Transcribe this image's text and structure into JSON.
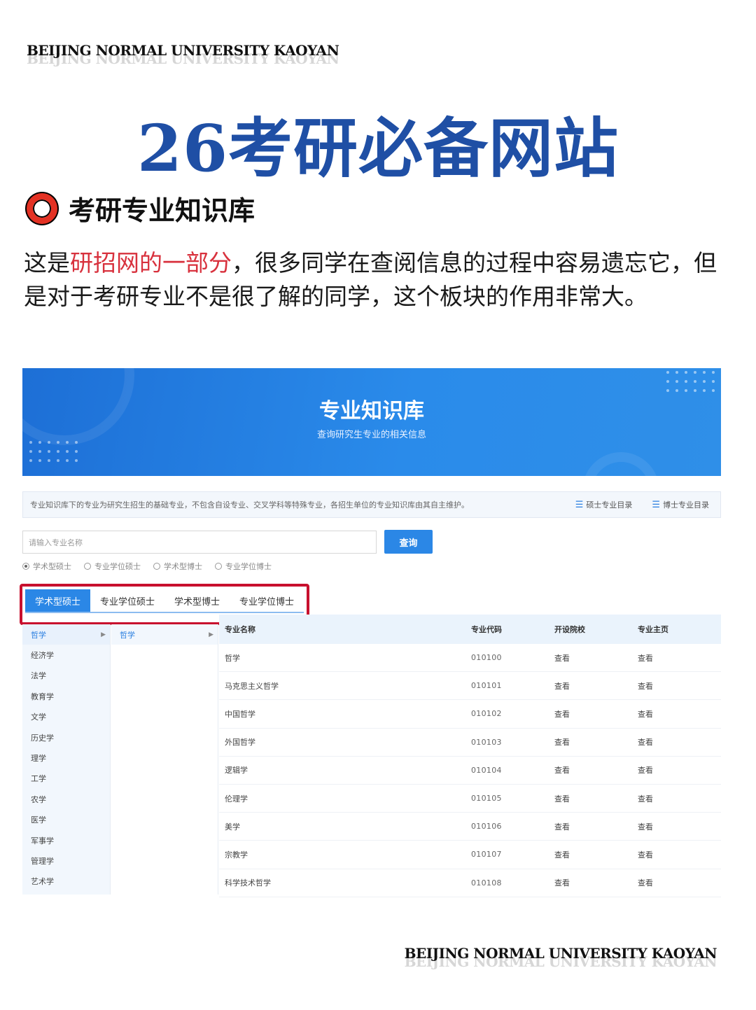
{
  "brand": "BEIJING NORMAL UNIVERSITY KAOYAN",
  "title": "26考研必备网站",
  "section_title": "考研专业知识库",
  "paragraph": {
    "part1": "这是",
    "highlight": "研招网的一部分",
    "part2": "，很多同学在查阅信息的过程中容易遗忘它，但是对于考研专业不是很了解的同学，这个板块的作用非常大。"
  },
  "colors": {
    "title_blue": "#1f4fa5",
    "highlight_red": "#d8313d",
    "ring_red": "#e33123",
    "box_red": "#c8102e",
    "site_blue": "#2b87e6"
  },
  "site": {
    "banner_title": "专业知识库",
    "banner_subtitle": "查询研究生专业的相关信息",
    "notice": "专业知识库下的专业为研究生招生的基础专业，不包含自设专业、交叉学科等特殊专业，各招生单位的专业知识库由其自主维护。",
    "links": [
      {
        "icon": "list-icon",
        "label": "硕士专业目录"
      },
      {
        "icon": "list-icon",
        "label": "博士专业目录"
      }
    ],
    "search_placeholder": "请输入专业名称",
    "search_button": "查询",
    "radios": [
      {
        "label": "学术型硕士",
        "checked": true
      },
      {
        "label": "专业学位硕士",
        "checked": false
      },
      {
        "label": "学术型博士",
        "checked": false
      },
      {
        "label": "专业学位博士",
        "checked": false
      }
    ],
    "tabs": [
      {
        "label": "学术型硕士",
        "active": true
      },
      {
        "label": "专业学位硕士",
        "active": false
      },
      {
        "label": "学术型博士",
        "active": false
      },
      {
        "label": "专业学位博士",
        "active": false
      }
    ],
    "categories": [
      "哲学",
      "经济学",
      "法学",
      "教育学",
      "文学",
      "历史学",
      "理学",
      "工学",
      "农学",
      "医学",
      "军事学",
      "管理学",
      "艺术学"
    ],
    "selected_category": "哲学",
    "subcategory": "哲学",
    "table": {
      "headers": [
        "专业名称",
        "专业代码",
        "开设院校",
        "专业主页"
      ],
      "rows": [
        [
          "哲学",
          "010100",
          "查看",
          "查看"
        ],
        [
          "马克思主义哲学",
          "010101",
          "查看",
          "查看"
        ],
        [
          "中国哲学",
          "010102",
          "查看",
          "查看"
        ],
        [
          "外国哲学",
          "010103",
          "查看",
          "查看"
        ],
        [
          "逻辑学",
          "010104",
          "查看",
          "查看"
        ],
        [
          "伦理学",
          "010105",
          "查看",
          "查看"
        ],
        [
          "美学",
          "010106",
          "查看",
          "查看"
        ],
        [
          "宗教学",
          "010107",
          "查看",
          "查看"
        ],
        [
          "科学技术哲学",
          "010108",
          "查看",
          "查看"
        ]
      ]
    }
  }
}
